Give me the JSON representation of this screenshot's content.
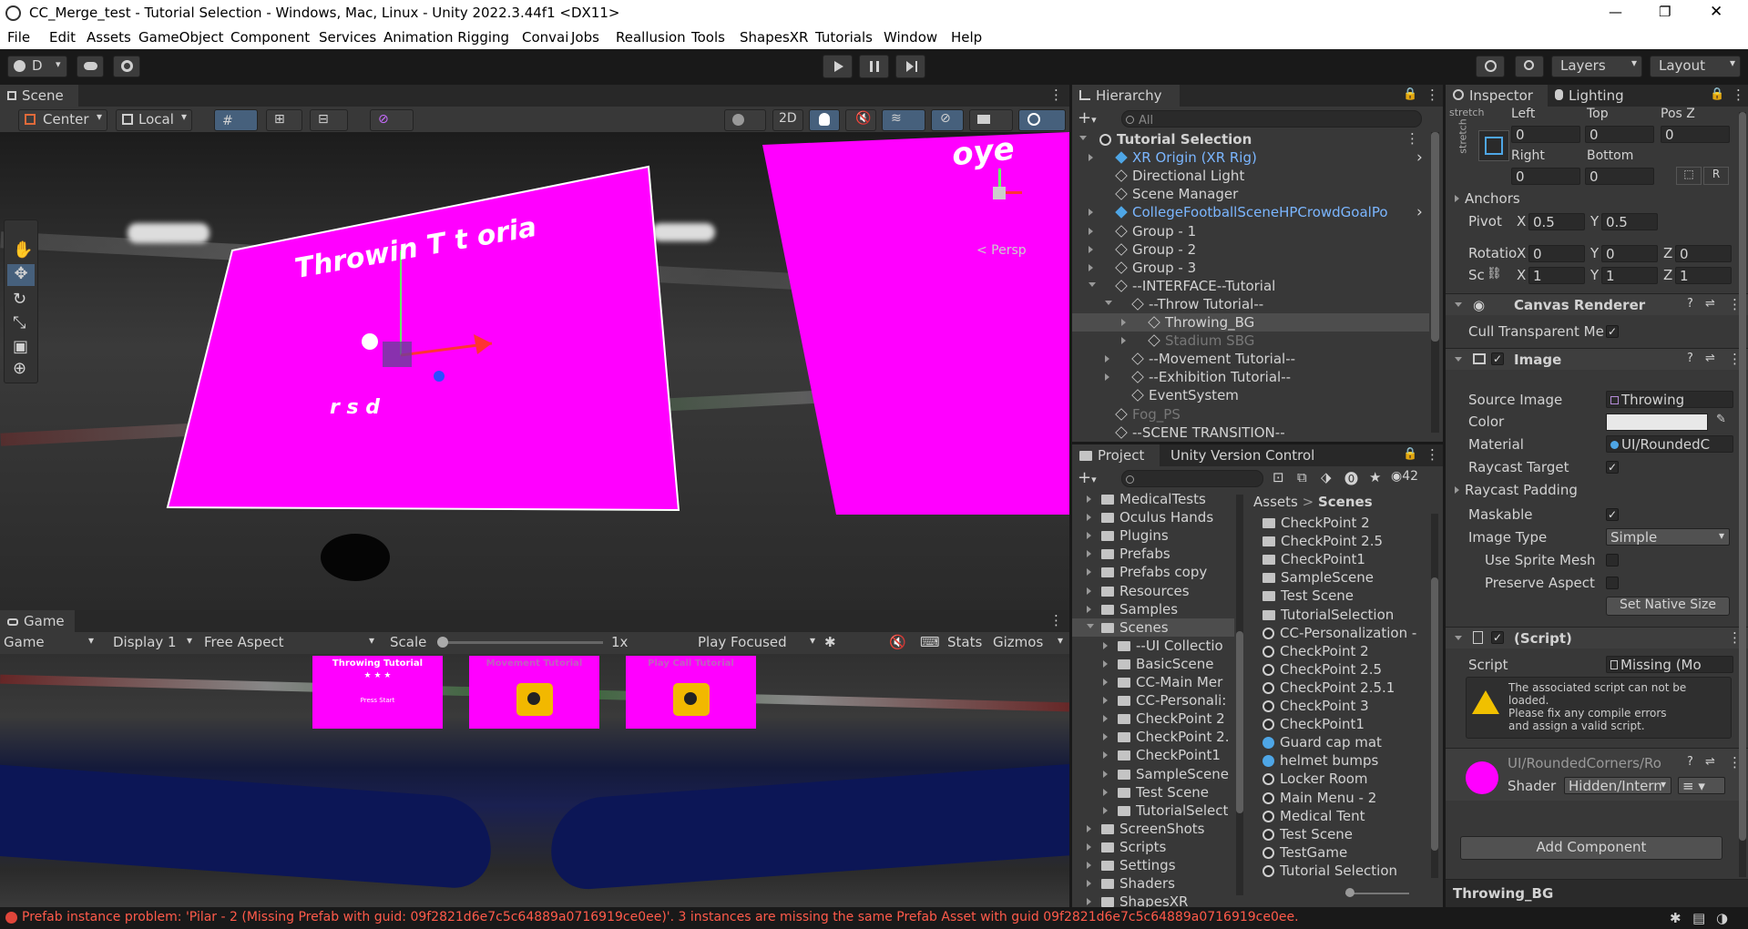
{
  "window": {
    "title": "CC_Merge_test - Tutorial Selection - Windows, Mac, Linux - Unity 2022.3.44f1 <DX11>",
    "minimize": "—",
    "maximize": "❐",
    "close": "✕"
  },
  "menu": [
    "File",
    "Edit",
    "Assets",
    "GameObject",
    "Component",
    "Services",
    "Animation Rigging",
    "Convai",
    "Jobs",
    "Reallusion",
    "Tools",
    "ShapesXR",
    "Tutorials",
    "Window",
    "Help"
  ],
  "toolbar": {
    "account": "D",
    "layers": "Layers",
    "layout": "Layout"
  },
  "scene": {
    "tab": "Scene",
    "pivot": "Center",
    "space": "Local",
    "mode2d": "2D",
    "persp": "< Persp",
    "sign_text1": "Throwin  T  t  oria ",
    "sign_text2": "r  s  d",
    "sign2_text": "oye"
  },
  "game": {
    "tab": "Game",
    "view": "Game",
    "display": "Display 1",
    "aspect": "Free Aspect",
    "scale_label": "Scale",
    "scale_value": "1x",
    "play_mode": "Play Focused",
    "stats": "Stats",
    "gizmos": "Gizmos",
    "cards": [
      {
        "title": "Throwing Tutorial",
        "sub": "★ ★ ★",
        "btn": "Press Start"
      },
      {
        "title": "Movement Tutorial"
      },
      {
        "title": "Play Call Tutorial"
      }
    ]
  },
  "hierarchy": {
    "tab": "Hierarchy",
    "search": "All",
    "items": [
      {
        "label": "Tutorial Selection",
        "indent": 0,
        "kind": "unity",
        "bold": true
      },
      {
        "label": "XR Origin (XR Rig)",
        "indent": 1,
        "kind": "prefab",
        "blue": true
      },
      {
        "label": "Directional Light",
        "indent": 1,
        "kind": "cube"
      },
      {
        "label": "Scene Manager",
        "indent": 1,
        "kind": "cube"
      },
      {
        "label": "CollegeFootballSceneHPCrowdGoalPo",
        "indent": 1,
        "kind": "prefab",
        "blue": true
      },
      {
        "label": "Group - 1",
        "indent": 1,
        "kind": "cube"
      },
      {
        "label": "Group - 2",
        "indent": 1,
        "kind": "cube"
      },
      {
        "label": "Group - 3",
        "indent": 1,
        "kind": "cube"
      },
      {
        "label": "--INTERFACE--Tutorial",
        "indent": 1,
        "kind": "cube"
      },
      {
        "label": "--Throw Tutorial--",
        "indent": 2,
        "kind": "cube"
      },
      {
        "label": "Throwing_BG",
        "indent": 3,
        "kind": "cube",
        "selected": true
      },
      {
        "label": "Stadium SBG",
        "indent": 3,
        "kind": "cube",
        "dim": true
      },
      {
        "label": "--Movement Tutorial--",
        "indent": 2,
        "kind": "cube"
      },
      {
        "label": "--Exhibition Tutorial--",
        "indent": 2,
        "kind": "cube"
      },
      {
        "label": "EventSystem",
        "indent": 2,
        "kind": "cube"
      },
      {
        "label": "Fog_PS",
        "indent": 1,
        "kind": "cube",
        "dim": true
      },
      {
        "label": "--SCENE TRANSITION--",
        "indent": 1,
        "kind": "cube"
      }
    ]
  },
  "project": {
    "tabs": [
      "Project",
      "Unity Version Control"
    ],
    "count": "42",
    "breadcrumb": [
      "Assets",
      "Scenes"
    ],
    "tree": [
      {
        "label": "MedicalTests",
        "indent": 0
      },
      {
        "label": "Oculus Hands",
        "indent": 0
      },
      {
        "label": "Plugins",
        "indent": 0
      },
      {
        "label": "Prefabs",
        "indent": 0
      },
      {
        "label": "Prefabs copy",
        "indent": 0
      },
      {
        "label": "Resources",
        "indent": 0
      },
      {
        "label": "Samples",
        "indent": 0
      },
      {
        "label": "Scenes",
        "indent": 0,
        "selected": true,
        "open": true
      },
      {
        "label": "--UI Collectio",
        "indent": 1
      },
      {
        "label": "BasicScene",
        "indent": 1
      },
      {
        "label": "CC-Main Mer",
        "indent": 1
      },
      {
        "label": "CC-Personali:",
        "indent": 1
      },
      {
        "label": "CheckPoint 2",
        "indent": 1
      },
      {
        "label": "CheckPoint 2.",
        "indent": 1
      },
      {
        "label": "CheckPoint1",
        "indent": 1
      },
      {
        "label": "SampleScene",
        "indent": 1
      },
      {
        "label": "Test Scene",
        "indent": 1
      },
      {
        "label": "TutorialSelect",
        "indent": 1
      },
      {
        "label": "ScreenShots",
        "indent": 0
      },
      {
        "label": "Scripts",
        "indent": 0
      },
      {
        "label": "Settings",
        "indent": 0
      },
      {
        "label": "Shaders",
        "indent": 0
      },
      {
        "label": "ShapesXR",
        "indent": 0
      }
    ],
    "files": [
      {
        "label": "CheckPoint 2",
        "kind": "folder"
      },
      {
        "label": "CheckPoint 2.5",
        "kind": "folder"
      },
      {
        "label": "CheckPoint1",
        "kind": "folder"
      },
      {
        "label": "SampleScene",
        "kind": "folder"
      },
      {
        "label": "Test Scene",
        "kind": "folder"
      },
      {
        "label": "TutorialSelection",
        "kind": "folder"
      },
      {
        "label": "CC-Personalization -",
        "kind": "unity"
      },
      {
        "label": "CheckPoint 2",
        "kind": "unity"
      },
      {
        "label": "CheckPoint 2.5",
        "kind": "unity"
      },
      {
        "label": "CheckPoint 2.5.1",
        "kind": "unity"
      },
      {
        "label": "CheckPoint 3",
        "kind": "unity"
      },
      {
        "label": "CheckPoint1",
        "kind": "unity"
      },
      {
        "label": "Guard cap mat",
        "kind": "mat"
      },
      {
        "label": "helmet bumps",
        "kind": "mat"
      },
      {
        "label": "Locker Room",
        "kind": "unity"
      },
      {
        "label": "Main Menu - 2",
        "kind": "unity"
      },
      {
        "label": "Medical Tent",
        "kind": "unity"
      },
      {
        "label": "Test Scene",
        "kind": "unity"
      },
      {
        "label": "TestGame",
        "kind": "unity"
      },
      {
        "label": "Tutorial Selection",
        "kind": "unity"
      }
    ]
  },
  "inspector": {
    "tabs": [
      "Inspector",
      "Lighting"
    ],
    "rect": {
      "stretch": "stretch",
      "left_l": "Left",
      "top_l": "Top",
      "posz_l": "Pos Z",
      "left": "0",
      "top": "0",
      "posz": "0",
      "right_l": "Right",
      "bottom_l": "Bottom",
      "right": "0",
      "bottom": "0",
      "r_btn": "R"
    },
    "anchors": "Anchors",
    "pivot_l": "Pivot",
    "pivot_x": "0.5",
    "pivot_y": "0.5",
    "rotation_l": "Rotatio",
    "rot": [
      "0",
      "0",
      "0"
    ],
    "scale_l": "Sc",
    "scale": [
      "1",
      "1",
      "1"
    ],
    "canvas_renderer": {
      "title": "Canvas Renderer",
      "cull": "Cull Transparent Me"
    },
    "image": {
      "title": "Image",
      "source_l": "Source Image",
      "source": "Throwing",
      "color_l": "Color",
      "material_l": "Material",
      "material": "UI/RoundedC",
      "raycast_l": "Raycast Target",
      "padding_l": "Raycast Padding",
      "maskable_l": "Maskable",
      "type_l": "Image Type",
      "type": "Simple",
      "sprite_mesh_l": "Use Sprite Mesh",
      "preserve_l": "Preserve Aspect",
      "native_btn": "Set Native Size"
    },
    "script": {
      "title": "(Script)",
      "script_l": "Script",
      "script": "Missing (Mo",
      "warning": [
        "The associated script can not be",
        "loaded.",
        "Please fix any compile errors",
        "and assign a valid script."
      ]
    },
    "shader_block": {
      "title": "UI/RoundedCorners/Ro",
      "shader_l": "Shader",
      "shader": "Hidden/Intern"
    },
    "add_component": "Add Component",
    "footer": "Throwing_BG"
  },
  "status": {
    "error": "Prefab instance problem: 'Pilar - 2 (Missing Prefab with guid: 09f2821d6e7c5c64889a0716919ce0ee)'. 3 instances are missing the same Prefab Asset with guid 09f2821d6e7c5c64889a0716919ce0ee."
  },
  "colors": {
    "accent": "#3a79bb",
    "magenta": "#ff00ff",
    "error": "#ff5a4a",
    "prefab": "#7bb6ff"
  }
}
